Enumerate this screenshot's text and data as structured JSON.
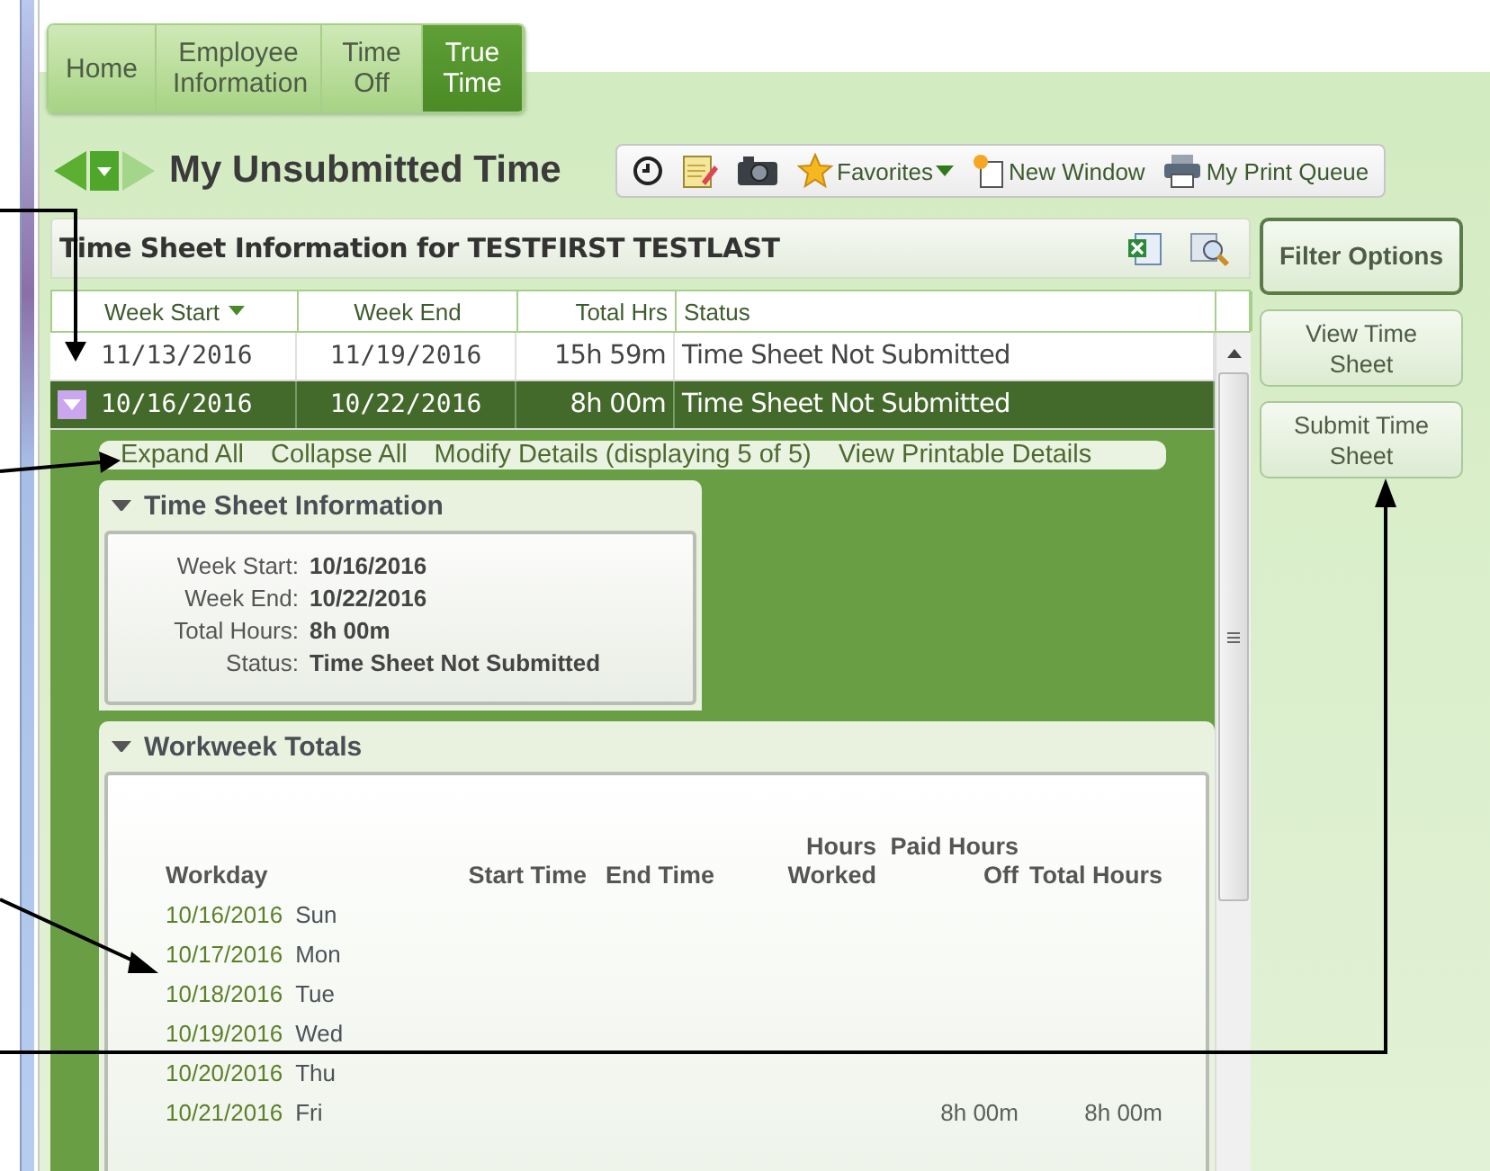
{
  "tabs": [
    {
      "label": "Home",
      "selected": false
    },
    {
      "label": "Employee Information",
      "selected": false
    },
    {
      "label": "Time Off",
      "selected": false
    },
    {
      "label": "True Time",
      "selected": true
    }
  ],
  "page_title": "My Unsubmitted Time",
  "toolbar": [
    {
      "kind": "clock"
    },
    {
      "kind": "notes"
    },
    {
      "kind": "camera"
    },
    {
      "kind": "favorites",
      "label": "Favorites"
    },
    {
      "kind": "window",
      "label": "New Window"
    },
    {
      "kind": "print",
      "label": "My Print Queue"
    }
  ],
  "panel_title": "Time Sheet Information for TESTFIRST TESTLAST",
  "table": {
    "columns": [
      "Week Start",
      "Week End",
      "Total Hrs",
      "Status"
    ],
    "rows": [
      {
        "week_start": "11/13/2016",
        "week_end": "11/19/2016",
        "total_hrs": "15h 59m",
        "status": "Time Sheet Not Submitted",
        "selected": false,
        "expanded": false
      },
      {
        "week_start": "10/16/2016",
        "week_end": "10/22/2016",
        "total_hrs": "8h 00m",
        "status": "Time Sheet Not Submitted",
        "selected": true,
        "expanded": true
      }
    ]
  },
  "detail_links": [
    "Expand All",
    "Collapse All",
    "Modify Details (displaying 5 of 5)",
    "View Printable Details"
  ],
  "info_section": {
    "title": "Time Sheet Information",
    "fields": [
      {
        "label": "Week Start:",
        "value": "10/16/2016"
      },
      {
        "label": "Week End:",
        "value": "10/22/2016"
      },
      {
        "label": "Total Hours:",
        "value": "8h 00m"
      },
      {
        "label": "Status:",
        "value": "Time Sheet Not Submitted"
      }
    ]
  },
  "workweek_section": {
    "title": "Workweek Totals",
    "columns": [
      "Workday",
      "Start Time",
      "End Time",
      "Hours Worked",
      "Paid Hours Off",
      "Total Hours"
    ],
    "rows": [
      {
        "date": "10/16/2016",
        "day": "Sun"
      },
      {
        "date": "10/17/2016",
        "day": "Mon"
      },
      {
        "date": "10/18/2016",
        "day": "Tue"
      },
      {
        "date": "10/19/2016",
        "day": "Wed"
      },
      {
        "date": "10/20/2016",
        "day": "Thu"
      },
      {
        "date": "10/21/2016",
        "day": "Fri",
        "paid_hours_off": "8h 00m",
        "total_hours": "8h 00m"
      }
    ]
  },
  "side_buttons": [
    {
      "label": "Filter Options",
      "kind": "primary"
    },
    {
      "label": "View Time Sheet",
      "kind": "secondary"
    },
    {
      "label": "Submit Time Sheet",
      "kind": "secondary"
    }
  ]
}
